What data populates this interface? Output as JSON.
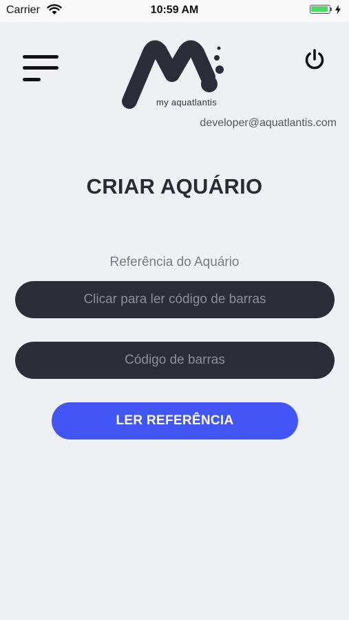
{
  "status_bar": {
    "carrier": "Carrier",
    "time": "10:59 AM",
    "wifi_icon": "wifi-icon",
    "battery_icon": "battery-charging-icon",
    "battery_level": 0.9
  },
  "header": {
    "menu_icon": "hamburger-menu-icon",
    "logo_text": "my aquatlantis",
    "power_icon": "power-icon",
    "user_email": "developer@aquatlantis.com"
  },
  "main": {
    "title": "CRIAR AQUÁRIO",
    "field_label": "Referência do Aquário",
    "scan_input_placeholder": "Clicar para ler código de barras",
    "barcode_input_placeholder": "Código de barras",
    "submit_label": "LER REFERÊNCIA"
  },
  "colors": {
    "background": "#eff0f3",
    "input_background": "#2c2d39",
    "primary": "#4255f5",
    "text_dark": "#2a2b34"
  }
}
